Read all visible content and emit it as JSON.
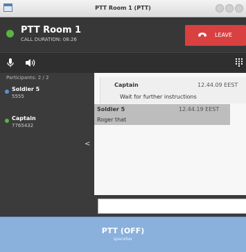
{
  "window": {
    "title": "PTT Room 1 (PTT)"
  },
  "header": {
    "room_name": "PTT Room 1",
    "call_duration": "CALL DURATION: 08:26",
    "leave_label": "LEAVE"
  },
  "sidebar": {
    "participants_count": "Participants: 2 / 2",
    "participants": [
      {
        "name": "Soldier 5",
        "id": "5555",
        "status_color": "#5b8fd6"
      },
      {
        "name": "Captain",
        "id": "7765432",
        "status_color": "#5ab540"
      }
    ],
    "collapse_icon": "chevron-left-icon"
  },
  "chat": {
    "messages": [
      {
        "sender": "Captain",
        "time": "12.44.09 EEST",
        "text": "Wait for further instructions"
      },
      {
        "sender": "Soldier 5",
        "time": "12.44.19 EEST",
        "text": "Roger that"
      }
    ],
    "input_value": ""
  },
  "ptt": {
    "label": "PTT (OFF)",
    "hint": "spacebar"
  },
  "colors": {
    "header_bg": "#373737",
    "leave": "#d94040",
    "online": "#5ab540",
    "ptt_bg": "#8ab0dc"
  }
}
